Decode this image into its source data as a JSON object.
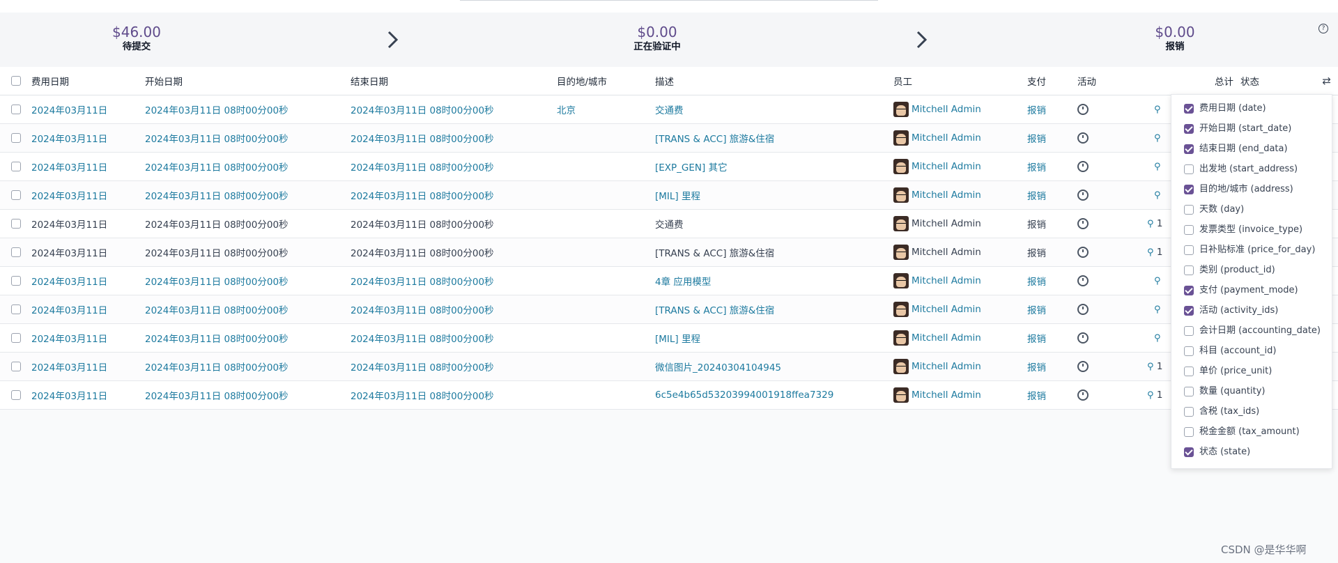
{
  "summary": {
    "stages": [
      {
        "amount": "$46.00",
        "label": "待提交"
      },
      {
        "amount": "$0.00",
        "label": "正在验证中"
      },
      {
        "amount": "$0.00",
        "label": "报销"
      }
    ],
    "help_icon": "?"
  },
  "table": {
    "headers": {
      "expense_date": "费用日期",
      "start_date": "开始日期",
      "end_date": "结束日期",
      "address": "目的地/城市",
      "description": "描述",
      "employee": "员工",
      "payment": "支付",
      "activity": "活动",
      "total": "总计",
      "state": "状态"
    },
    "rows": [
      {
        "date": "2024年03月11日",
        "start": "2024年03月11日 08时00分00秒",
        "end": "2024年03月11日 08时00分00秒",
        "address": "北京",
        "desc": "交通费",
        "employee": "Mitchell Admin",
        "payment": "报销",
        "attach": "",
        "style": "link"
      },
      {
        "date": "2024年03月11日",
        "start": "2024年03月11日 08时00分00秒",
        "end": "2024年03月11日 08时00分00秒",
        "address": "",
        "desc": "[TRANS & ACC] 旅游&住宿",
        "employee": "Mitchell Admin",
        "payment": "报销",
        "attach": "",
        "style": "link"
      },
      {
        "date": "2024年03月11日",
        "start": "2024年03月11日 08时00分00秒",
        "end": "2024年03月11日 08时00分00秒",
        "address": "",
        "desc": "[EXP_GEN] 其它",
        "employee": "Mitchell Admin",
        "payment": "报销",
        "attach": "",
        "style": "link"
      },
      {
        "date": "2024年03月11日",
        "start": "2024年03月11日 08时00分00秒",
        "end": "2024年03月11日 08时00分00秒",
        "address": "",
        "desc": "[MIL] 里程",
        "employee": "Mitchell Admin",
        "payment": "报销",
        "attach": "",
        "style": "link"
      },
      {
        "date": "2024年03月11日",
        "start": "2024年03月11日 08时00分00秒",
        "end": "2024年03月11日 08时00分00秒",
        "address": "",
        "desc": "交通费",
        "employee": "Mitchell Admin",
        "payment": "报销",
        "attach": "1",
        "style": "plain"
      },
      {
        "date": "2024年03月11日",
        "start": "2024年03月11日 08时00分00秒",
        "end": "2024年03月11日 08时00分00秒",
        "address": "",
        "desc": "[TRANS & ACC] 旅游&住宿",
        "employee": "Mitchell Admin",
        "payment": "报销",
        "attach": "1",
        "style": "plain"
      },
      {
        "date": "2024年03月11日",
        "start": "2024年03月11日 08时00分00秒",
        "end": "2024年03月11日 08时00分00秒",
        "address": "",
        "desc": "4章 应用模型",
        "employee": "Mitchell Admin",
        "payment": "报销",
        "attach": "",
        "style": "link"
      },
      {
        "date": "2024年03月11日",
        "start": "2024年03月11日 08时00分00秒",
        "end": "2024年03月11日 08时00分00秒",
        "address": "",
        "desc": "[TRANS & ACC] 旅游&住宿",
        "employee": "Mitchell Admin",
        "payment": "报销",
        "attach": "",
        "style": "link"
      },
      {
        "date": "2024年03月11日",
        "start": "2024年03月11日 08时00分00秒",
        "end": "2024年03月11日 08时00分00秒",
        "address": "",
        "desc": "[MIL] 里程",
        "employee": "Mitchell Admin",
        "payment": "报销",
        "attach": "",
        "style": "link"
      },
      {
        "date": "2024年03月11日",
        "start": "2024年03月11日 08时00分00秒",
        "end": "2024年03月11日 08时00分00秒",
        "address": "",
        "desc": "微信图片_20240304104945",
        "employee": "Mitchell Admin",
        "payment": "报销",
        "attach": "1",
        "style": "link"
      },
      {
        "date": "2024年03月11日",
        "start": "2024年03月11日 08时00分00秒",
        "end": "2024年03月11日 08时00分00秒",
        "address": "",
        "desc": "6c5e4b65d53203994001918ffea7329",
        "employee": "Mitchell Admin",
        "payment": "报销",
        "attach": "1",
        "style": "link"
      }
    ]
  },
  "column_options": [
    {
      "label": "费用日期 (date)",
      "checked": true
    },
    {
      "label": "开始日期 (start_date)",
      "checked": true
    },
    {
      "label": "结束日期 (end_data)",
      "checked": true
    },
    {
      "label": "出发地 (start_address)",
      "checked": false
    },
    {
      "label": "目的地/城市 (address)",
      "checked": true
    },
    {
      "label": "天数 (day)",
      "checked": false
    },
    {
      "label": "发票类型 (invoice_type)",
      "checked": false
    },
    {
      "label": "日补贴标准 (price_for_day)",
      "checked": false
    },
    {
      "label": "类别 (product_id)",
      "checked": false
    },
    {
      "label": "支付 (payment_mode)",
      "checked": true
    },
    {
      "label": "活动 (activity_ids)",
      "checked": true
    },
    {
      "label": "会计日期 (accounting_date)",
      "checked": false
    },
    {
      "label": "科目 (account_id)",
      "checked": false
    },
    {
      "label": "单价 (price_unit)",
      "checked": false
    },
    {
      "label": "数量 (quantity)",
      "checked": false
    },
    {
      "label": "含税 (tax_ids)",
      "checked": false
    },
    {
      "label": "税金金额 (tax_amount)",
      "checked": false
    },
    {
      "label": "状态 (state)",
      "checked": true
    }
  ],
  "watermark": "CSDN @是华华啊",
  "colors": {
    "link": "#1d7a9f",
    "accent": "#6a5295",
    "amount": "#5f4b8b"
  }
}
